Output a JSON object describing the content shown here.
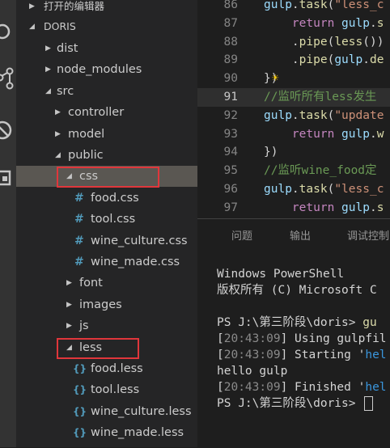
{
  "colors": {
    "activity_bar": "#333333",
    "sidebar": "#252526",
    "editor": "#1e1e1e",
    "selection": "#5a5752",
    "highlight_box": "#e0363b"
  },
  "activity_bar": {
    "icons": [
      "explorer-icon",
      "source-control-icon",
      "debug-icon",
      "extensions-icon"
    ]
  },
  "explorer": {
    "open_editors_label": "打开的编辑器",
    "project_label": "DORIS",
    "tree": [
      {
        "name": "dist",
        "depth": 1,
        "type": "folder",
        "expanded": false
      },
      {
        "name": "node_modules",
        "depth": 1,
        "type": "folder",
        "expanded": false
      },
      {
        "name": "src",
        "depth": 1,
        "type": "folder",
        "expanded": true
      },
      {
        "name": "controller",
        "depth": 2,
        "type": "folder",
        "expanded": false
      },
      {
        "name": "model",
        "depth": 2,
        "type": "folder",
        "expanded": false
      },
      {
        "name": "public",
        "depth": 2,
        "type": "folder",
        "expanded": true
      },
      {
        "name": "css",
        "depth": 3,
        "type": "folder",
        "expanded": true,
        "selected": true,
        "boxed": true
      },
      {
        "name": "food.css",
        "depth": 4,
        "type": "css"
      },
      {
        "name": "tool.css",
        "depth": 4,
        "type": "css"
      },
      {
        "name": "wine_culture.css",
        "depth": 4,
        "type": "css"
      },
      {
        "name": "wine_made.css",
        "depth": 4,
        "type": "css"
      },
      {
        "name": "font",
        "depth": 3,
        "type": "folder",
        "expanded": false
      },
      {
        "name": "images",
        "depth": 3,
        "type": "folder",
        "expanded": false
      },
      {
        "name": "js",
        "depth": 3,
        "type": "folder",
        "expanded": false
      },
      {
        "name": "less",
        "depth": 3,
        "type": "folder",
        "expanded": true,
        "boxed": true
      },
      {
        "name": "food.less",
        "depth": 4,
        "type": "less"
      },
      {
        "name": "tool.less",
        "depth": 4,
        "type": "less"
      },
      {
        "name": "wine_culture.less",
        "depth": 4,
        "type": "less"
      },
      {
        "name": "wine_made.less",
        "depth": 4,
        "type": "less"
      }
    ]
  },
  "editor": {
    "active_line": "91",
    "lines": [
      {
        "num": "86",
        "tokens": [
          [
            "var",
            "gulp"
          ],
          [
            "plain",
            "."
          ],
          [
            "fn",
            "task"
          ],
          [
            "plain",
            "("
          ],
          [
            "str",
            "\"less_c"
          ]
        ]
      },
      {
        "num": "87",
        "tokens": [
          [
            "plain",
            "    "
          ],
          [
            "kw",
            "return"
          ],
          [
            "plain",
            " "
          ],
          [
            "var",
            "gulp"
          ],
          [
            "plain",
            "."
          ],
          [
            "fn",
            "s"
          ]
        ]
      },
      {
        "num": "88",
        "tokens": [
          [
            "plain",
            "    ."
          ],
          [
            "fn",
            "pipe"
          ],
          [
            "plain",
            "("
          ],
          [
            "fn",
            "less"
          ],
          [
            "plain",
            "())"
          ]
        ]
      },
      {
        "num": "89",
        "tokens": [
          [
            "plain",
            "    ."
          ],
          [
            "fn",
            "pipe"
          ],
          [
            "plain",
            "("
          ],
          [
            "var",
            "gulp"
          ],
          [
            "plain",
            "."
          ],
          [
            "fn",
            "de"
          ]
        ]
      },
      {
        "num": "90",
        "tokens": [
          [
            "plain",
            "})"
          ]
        ],
        "bulb": true
      },
      {
        "num": "91",
        "tokens": [
          [
            "cm",
            "//监听所有less发生"
          ]
        ],
        "highlight": true
      },
      {
        "num": "92",
        "tokens": [
          [
            "var",
            "gulp"
          ],
          [
            "plain",
            "."
          ],
          [
            "fn",
            "task"
          ],
          [
            "plain",
            "("
          ],
          [
            "str",
            "\"update"
          ]
        ]
      },
      {
        "num": "93",
        "tokens": [
          [
            "plain",
            "    "
          ],
          [
            "kw",
            "return"
          ],
          [
            "plain",
            " "
          ],
          [
            "var",
            "gulp"
          ],
          [
            "plain",
            "."
          ],
          [
            "fn",
            "w"
          ]
        ]
      },
      {
        "num": "94",
        "tokens": [
          [
            "plain",
            "})"
          ]
        ]
      },
      {
        "num": "95",
        "tokens": [
          [
            "cm",
            "//监听wine_food定"
          ]
        ]
      },
      {
        "num": "96",
        "tokens": [
          [
            "var",
            "gulp"
          ],
          [
            "plain",
            "."
          ],
          [
            "fn",
            "task"
          ],
          [
            "plain",
            "("
          ],
          [
            "str",
            "\"less_c"
          ]
        ]
      },
      {
        "num": "97",
        "tokens": [
          [
            "plain",
            "    "
          ],
          [
            "kw",
            "return"
          ],
          [
            "plain",
            " "
          ],
          [
            "var",
            "gulp"
          ],
          [
            "plain",
            "."
          ],
          [
            "fn",
            "s"
          ]
        ]
      }
    ]
  },
  "panel": {
    "tabs": [
      "问题",
      "输出",
      "调试控制"
    ],
    "terminal": [
      [
        [
          "plain",
          "Windows PowerShell"
        ]
      ],
      [
        [
          "plain",
          "版权所有 (C) Microsoft C"
        ]
      ],
      [
        [
          "plain",
          ""
        ]
      ],
      [
        [
          "plain",
          "PS J:\\第三阶段\\doris> "
        ],
        [
          "fn",
          "gu"
        ]
      ],
      [
        [
          "plain",
          "["
        ],
        [
          "ts",
          "20:43:09"
        ],
        [
          "plain",
          "] Using gulpfil"
        ]
      ],
      [
        [
          "plain",
          "["
        ],
        [
          "ts",
          "20:43:09"
        ],
        [
          "plain",
          "] Starting '"
        ],
        [
          "tcyan",
          "hel"
        ]
      ],
      [
        [
          "plain",
          "hello gulp"
        ]
      ],
      [
        [
          "plain",
          "["
        ],
        [
          "ts",
          "20:43:09"
        ],
        [
          "plain",
          "] Finished '"
        ],
        [
          "tcyan",
          "hel"
        ]
      ],
      [
        [
          "plain",
          "PS J:\\第三阶段\\doris> "
        ]
      ]
    ]
  }
}
